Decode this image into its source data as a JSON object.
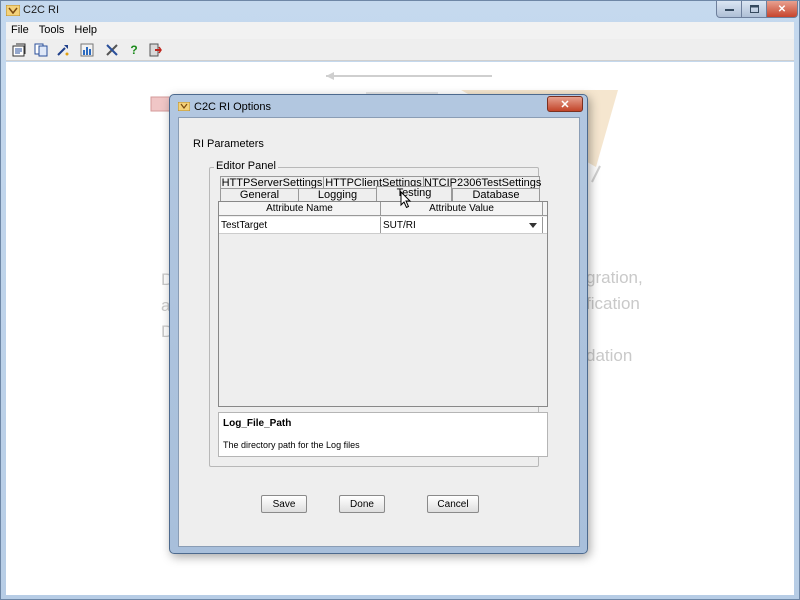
{
  "app": {
    "title": "C2C RI",
    "menu": [
      "File",
      "Tools",
      "Help"
    ],
    "toolbar_icons": [
      "open-config-icon",
      "copy-icon",
      "run-wizard-icon",
      "report-icon",
      "tools-icon",
      "help-icon",
      "exit-icon"
    ]
  },
  "background": {
    "lines": [
      "D",
      "a",
      "D",
      "gration,",
      "fication",
      "dation"
    ]
  },
  "dialog": {
    "title": "C2C RI Options",
    "section_label": "RI Parameters",
    "group_label": "Editor Panel",
    "tabs_row1": [
      "HTTPServerSettings",
      "HTTPClientSettings",
      "NTCIP2306TestSettings"
    ],
    "tabs_row2": [
      "General",
      "Logging",
      "Testing",
      "Database"
    ],
    "selected_tab": "Testing",
    "table": {
      "columns": [
        "Attribute Name",
        "Attribute Value"
      ],
      "rows": [
        {
          "name": "TestTarget",
          "value": "SUT/RI"
        }
      ]
    },
    "description": {
      "title": "Log_File_Path",
      "text": "The directory path for the Log files"
    },
    "buttons": {
      "save": "Save",
      "done": "Done",
      "cancel": "Cancel"
    }
  },
  "colors": {
    "window_frame": "#b7cde6",
    "close_red": "#c7442c"
  }
}
